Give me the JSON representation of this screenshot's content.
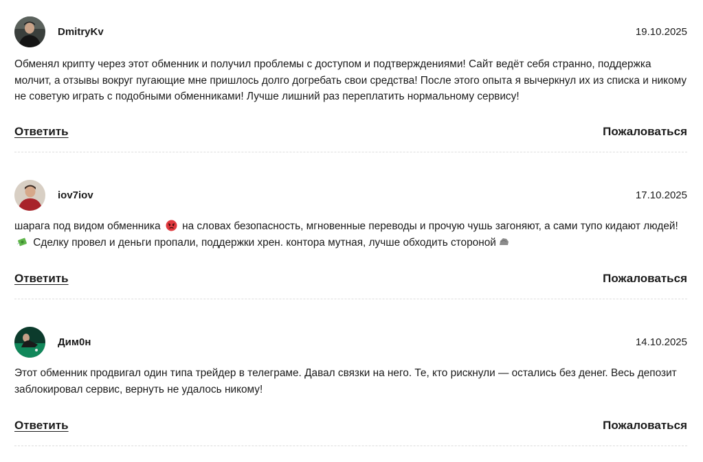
{
  "comments": [
    {
      "author": "DmitryKv",
      "date": "19.10.2025",
      "text": "Обменял крипту через этот обменник и получил проблемы с доступом и подтверждениями! Сайт ведёт себя странно, поддержка молчит, а отзывы вокруг пугающие мне пришлось долго догребать свои средства! После этого опыта я вычеркнул их из списка и никому не советую играть с подобными обменниками! Лучше лишний раз переплатить нормальному сервису!",
      "reply_label": "Ответить",
      "report_label": "Пожаловаться"
    },
    {
      "author": "iov7iov",
      "date": "17.10.2025",
      "text_part1": "шарага под видом обменника",
      "text_part2": "на словах безопасность, мгновенные переводы и прочую чушь загоняют, а сами тупо кидают людей!",
      "text_part3": "Сделку провел и деньги пропали, поддержки хрен. контора мутная, лучше обходить стороной",
      "emojis": [
        "angry-face-icon",
        "money-with-wings-icon",
        "rock-icon"
      ],
      "reply_label": "Ответить",
      "report_label": "Пожаловаться"
    },
    {
      "author": "Дим0н",
      "date": "14.10.2025",
      "text": "Этот обменник продвигал один типа трейдер в телеграме. Давал связки на него. Те, кто рискнули — остались без денег. Весь депозит заблокировал сервис, вернуть не удалось никому!",
      "reply_label": "Ответить",
      "report_label": "Пожаловаться"
    }
  ]
}
